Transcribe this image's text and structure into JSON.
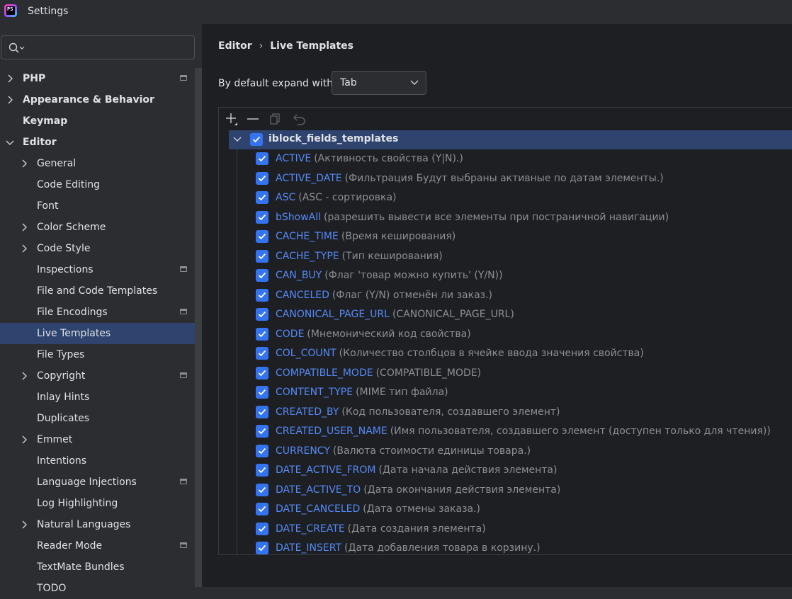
{
  "window": {
    "title": "Settings",
    "logo_text": "PS"
  },
  "search": {
    "placeholder": ""
  },
  "sidebar": {
    "items": [
      {
        "label": "PHP",
        "level": 0,
        "expandable": true,
        "expanded": false,
        "bold": true,
        "project_icon": true
      },
      {
        "label": "Appearance & Behavior",
        "level": 0,
        "expandable": true,
        "expanded": false,
        "bold": true,
        "project_icon": false
      },
      {
        "label": "Keymap",
        "level": 0,
        "expandable": false,
        "expanded": false,
        "bold": true,
        "project_icon": false
      },
      {
        "label": "Editor",
        "level": 0,
        "expandable": true,
        "expanded": true,
        "bold": true,
        "project_icon": false
      },
      {
        "label": "General",
        "level": 1,
        "expandable": true,
        "expanded": false,
        "bold": false,
        "project_icon": false
      },
      {
        "label": "Code Editing",
        "level": 1,
        "expandable": false,
        "expanded": false,
        "bold": false,
        "project_icon": false
      },
      {
        "label": "Font",
        "level": 1,
        "expandable": false,
        "expanded": false,
        "bold": false,
        "project_icon": false
      },
      {
        "label": "Color Scheme",
        "level": 1,
        "expandable": true,
        "expanded": false,
        "bold": false,
        "project_icon": false
      },
      {
        "label": "Code Style",
        "level": 1,
        "expandable": true,
        "expanded": false,
        "bold": false,
        "project_icon": false
      },
      {
        "label": "Inspections",
        "level": 1,
        "expandable": false,
        "expanded": false,
        "bold": false,
        "project_icon": true
      },
      {
        "label": "File and Code Templates",
        "level": 1,
        "expandable": false,
        "expanded": false,
        "bold": false,
        "project_icon": false
      },
      {
        "label": "File Encodings",
        "level": 1,
        "expandable": false,
        "expanded": false,
        "bold": false,
        "project_icon": true
      },
      {
        "label": "Live Templates",
        "level": 1,
        "expandable": false,
        "expanded": false,
        "bold": false,
        "project_icon": false,
        "selected": true
      },
      {
        "label": "File Types",
        "level": 1,
        "expandable": false,
        "expanded": false,
        "bold": false,
        "project_icon": false
      },
      {
        "label": "Copyright",
        "level": 1,
        "expandable": true,
        "expanded": false,
        "bold": false,
        "project_icon": true
      },
      {
        "label": "Inlay Hints",
        "level": 1,
        "expandable": false,
        "expanded": false,
        "bold": false,
        "project_icon": false
      },
      {
        "label": "Duplicates",
        "level": 1,
        "expandable": false,
        "expanded": false,
        "bold": false,
        "project_icon": false
      },
      {
        "label": "Emmet",
        "level": 1,
        "expandable": true,
        "expanded": false,
        "bold": false,
        "project_icon": false
      },
      {
        "label": "Intentions",
        "level": 1,
        "expandable": false,
        "expanded": false,
        "bold": false,
        "project_icon": false
      },
      {
        "label": "Language Injections",
        "level": 1,
        "expandable": false,
        "expanded": false,
        "bold": false,
        "project_icon": true
      },
      {
        "label": "Log Highlighting",
        "level": 1,
        "expandable": false,
        "expanded": false,
        "bold": false,
        "project_icon": false
      },
      {
        "label": "Natural Languages",
        "level": 1,
        "expandable": true,
        "expanded": false,
        "bold": false,
        "project_icon": false
      },
      {
        "label": "Reader Mode",
        "level": 1,
        "expandable": false,
        "expanded": false,
        "bold": false,
        "project_icon": true
      },
      {
        "label": "TextMate Bundles",
        "level": 1,
        "expandable": false,
        "expanded": false,
        "bold": false,
        "project_icon": false
      },
      {
        "label": "TODO",
        "level": 1,
        "expandable": false,
        "expanded": false,
        "bold": false,
        "project_icon": false
      }
    ]
  },
  "breadcrumb": {
    "parent": "Editor",
    "current": "Live Templates"
  },
  "expand_with": {
    "label": "By default expand with",
    "value": "Tab"
  },
  "toolbar": {
    "icons": [
      "add-icon",
      "remove-icon",
      "copy-icon",
      "revert-icon"
    ]
  },
  "templates": {
    "group": {
      "name": "iblock_fields_templates",
      "checked": true,
      "expanded": true
    },
    "items": [
      {
        "abbr": "ACTIVE",
        "desc": "(Активность свойства (Y|N).)",
        "checked": true
      },
      {
        "abbr": "ACTIVE_DATE",
        "desc": "(Фильтрация Будут выбраны активные по датам элементы.)",
        "checked": true
      },
      {
        "abbr": "ASC",
        "desc": "(ASC - сортировка)",
        "checked": true
      },
      {
        "abbr": "bShowAll",
        "desc": "(разрешить вывести все элементы при постраничной навигации)",
        "checked": true
      },
      {
        "abbr": "CACHE_TIME",
        "desc": "(Время кеширования)",
        "checked": true
      },
      {
        "abbr": "CACHE_TYPE",
        "desc": "(Тип кеширования)",
        "checked": true
      },
      {
        "abbr": "CAN_BUY",
        "desc": "(Флаг 'товар можно купить' (Y/N))",
        "checked": true
      },
      {
        "abbr": "CANCELED",
        "desc": "(Флаг (Y/N) отменён ли заказ.)",
        "checked": true
      },
      {
        "abbr": "CANONICAL_PAGE_URL",
        "desc": "(CANONICAL_PAGE_URL)",
        "checked": true
      },
      {
        "abbr": "CODE",
        "desc": "(Мнемонический код свойства)",
        "checked": true
      },
      {
        "abbr": "COL_COUNT",
        "desc": "(Количество столбцов в ячейке ввода значения свойства)",
        "checked": true
      },
      {
        "abbr": "COMPATIBLE_MODE",
        "desc": "(COMPATIBLE_MODE)",
        "checked": true
      },
      {
        "abbr": "CONTENT_TYPE",
        "desc": "(MIME тип файла)",
        "checked": true
      },
      {
        "abbr": "CREATED_BY",
        "desc": "(Код пользователя, создавшего элемент)",
        "checked": true
      },
      {
        "abbr": "CREATED_USER_NAME",
        "desc": "(Имя пользователя, создавшего элемент (доступен только для чтения))",
        "checked": true
      },
      {
        "abbr": "CURRENCY",
        "desc": "(Валюта стоимости единицы товара.)",
        "checked": true
      },
      {
        "abbr": "DATE_ACTIVE_FROM",
        "desc": "(Дата начала действия элемента)",
        "checked": true
      },
      {
        "abbr": "DATE_ACTIVE_TO",
        "desc": "(Дата окончания действия элемента)",
        "checked": true
      },
      {
        "abbr": "DATE_CANCELED",
        "desc": "(Дата отмены заказа.)",
        "checked": true
      },
      {
        "abbr": "DATE_CREATE",
        "desc": "(Дата создания элемента)",
        "checked": true
      },
      {
        "abbr": "DATE_INSERT",
        "desc": "(Дата добавления товара в корзину.)",
        "checked": true
      }
    ]
  },
  "colors": {
    "accent": "#3574f0",
    "selection": "#2e436e",
    "link": "#548af7",
    "muted": "#8c8f94"
  }
}
